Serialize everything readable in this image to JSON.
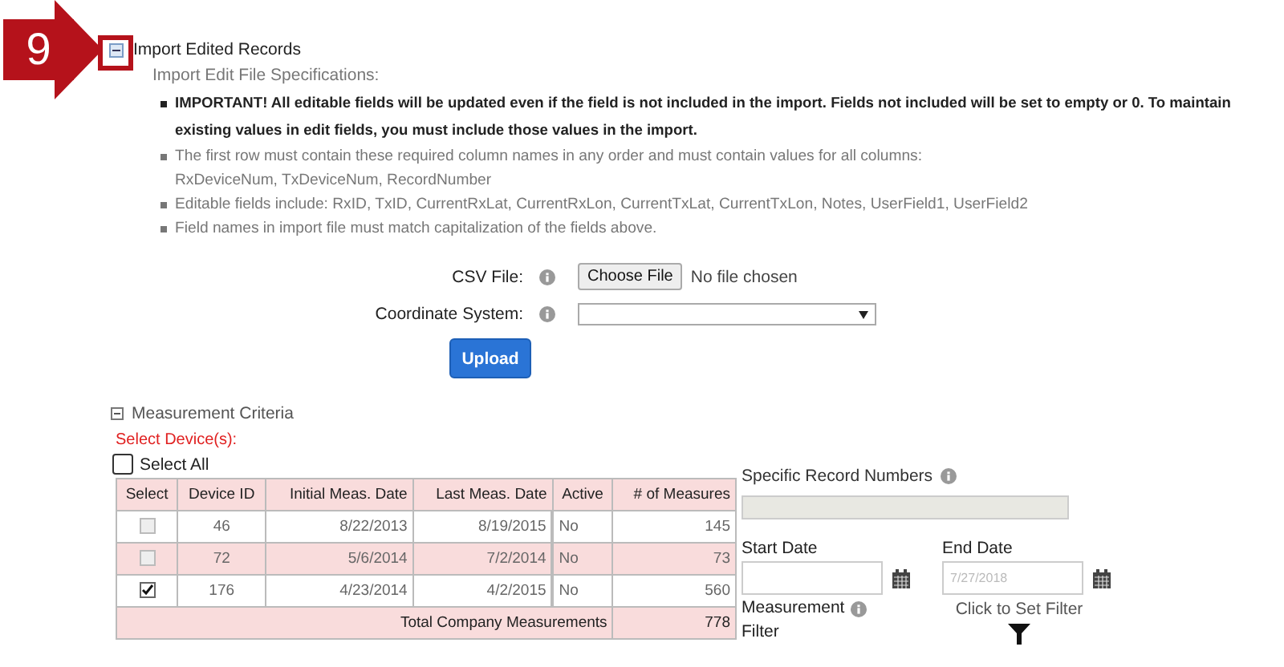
{
  "callout": {
    "number": "9"
  },
  "import_section": {
    "title": "Import Edited Records",
    "expanded": true,
    "subtitle": "Import Edit File Specifications:",
    "bullets": [
      {
        "kind": "bold",
        "lines": [
          "IMPORTANT! All editable fields will be updated even if the field is not included in the import. Fields not included will be set to empty or 0. To maintain existing values in edit fields, you must include those values in the import."
        ]
      },
      {
        "kind": "plain",
        "lines": [
          "The first row must contain these required column names in any order and must contain values for all columns:",
          "RxDeviceNum, TxDeviceNum, RecordNumber"
        ]
      },
      {
        "kind": "plain",
        "lines": [
          "Editable fields include: RxID, TxID, CurrentRxLat, CurrentRxLon, CurrentTxLat, CurrentTxLon, Notes, UserField1, UserField2"
        ]
      },
      {
        "kind": "plain",
        "lines": [
          "Field names in import file must match capitalization of the fields above."
        ]
      }
    ]
  },
  "form": {
    "csv_label": "CSV File:",
    "choose_button": "Choose File",
    "file_status": "No file chosen",
    "coordinate_label": "Coordinate System:",
    "upload_button": "Upload"
  },
  "measurement": {
    "title": "Measurement Criteria",
    "expanded": true,
    "select_devices": "Select Device(s):",
    "select_all": {
      "label": "Select All",
      "checked": false
    },
    "columns": [
      "Select",
      "Device ID",
      "Initial Meas. Date",
      "Last Meas. Date",
      "Active",
      "# of Measures"
    ],
    "rows": [
      {
        "selected": false,
        "device_id": "46",
        "initial": "8/22/2013",
        "last": "8/19/2015",
        "active": "No",
        "measures": "145"
      },
      {
        "selected": false,
        "device_id": "72",
        "initial": "5/6/2014",
        "last": "7/2/2014",
        "active": "No",
        "measures": "73"
      },
      {
        "selected": true,
        "device_id": "176",
        "initial": "4/23/2014",
        "last": "4/2/2015",
        "active": "No",
        "measures": "560"
      }
    ],
    "total": {
      "label": "Total Company Measurements",
      "value": "778"
    }
  },
  "filters": {
    "record_numbers": {
      "label": "Specific Record Numbers",
      "disabled": true
    },
    "start_date": {
      "label": "Start Date"
    },
    "end_date": {
      "label": "End Date",
      "placeholder": "7/27/2018"
    },
    "measurement_filter": {
      "label": "Measurement Filter",
      "click_text": "Click to Set Filter"
    }
  }
}
